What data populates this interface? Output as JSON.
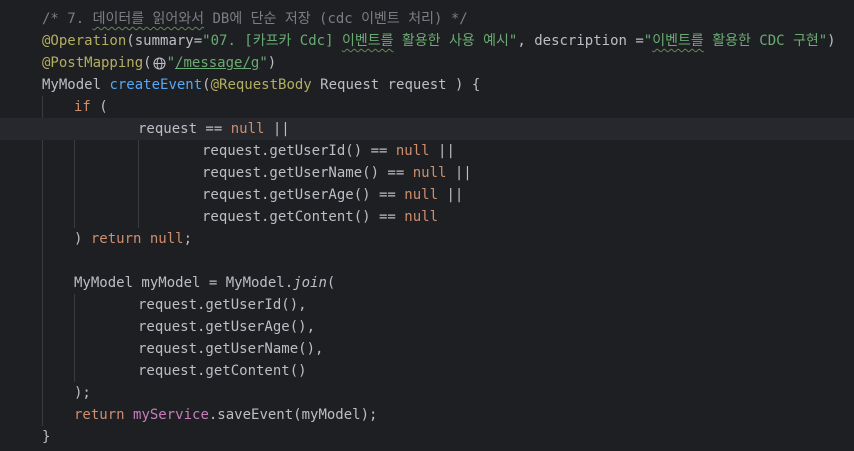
{
  "editor": {
    "lines": {
      "l1": {
        "comment_a": "/* 7. ",
        "comment_b": "데이터를 읽어와서",
        "comment_c": " DB에 단순 저장 (cdc 이벤트 처리) */"
      },
      "l2": {
        "annotation": "@Operation",
        "paren_open": "(summary=",
        "summary_a": "\"07. [카프카 Cdc] ",
        "summary_b": "이벤트를",
        "summary_c": " 활용한 사용 예시\"",
        "sep": ", description =",
        "desc_a": "\"",
        "desc_b": "이벤트를",
        "desc_c": " 활용한 CDC 구현\"",
        "close": ")"
      },
      "l3": {
        "annotation": "@PostMapping",
        "paren_open": "(",
        "quote_open": "\"",
        "path": "/message/g",
        "quote_close": "\"",
        "paren_close": ")"
      },
      "l4": {
        "type": "MyModel ",
        "method": "createEvent",
        "open": "(",
        "annotation": "@RequestBody",
        "rest": " Request request ) {"
      },
      "l5": {
        "kw": "if",
        "rest": " ("
      },
      "l6": {
        "text": "request == ",
        "kw": "null",
        "rest": " ||"
      },
      "l7": {
        "text": "request.getUserId() == ",
        "kw": "null",
        "rest": " ||"
      },
      "l8": {
        "text": "request.getUserName() == ",
        "kw": "null",
        "rest": " ||"
      },
      "l9": {
        "text": "request.getUserAge() == ",
        "kw": "null",
        "rest": " ||"
      },
      "l10": {
        "text": "request.getContent() == ",
        "kw": "null"
      },
      "l11": {
        "close": ") ",
        "kw_return": "return",
        "space": " ",
        "kw_null": "null",
        "semi": ";"
      },
      "l13": {
        "text": "MyModel myModel = MyModel.",
        "method": "join",
        "open": "("
      },
      "l14": {
        "text": "request.getUserId(),"
      },
      "l15": {
        "text": "request.getUserAge(),"
      },
      "l16": {
        "text": "request.getUserName(),"
      },
      "l17": {
        "text": "request.getContent()"
      },
      "l18": {
        "text": ");"
      },
      "l19": {
        "kw": "return",
        "space": " ",
        "field": "myService",
        "rest": ".saveEvent(myModel);"
      },
      "l20": {
        "text": "}"
      }
    }
  },
  "icons": {
    "intention": "lightbulb-icon",
    "url": "globe-icon"
  },
  "colors": {
    "background": "#1e1f22",
    "text": "#bcbec4",
    "comment": "#7a7e85",
    "annotation": "#b3ae60",
    "keyword": "#cf8e6d",
    "string": "#6aab73",
    "method": "#56a8f5",
    "field": "#c77dbb",
    "bulb": "#f2c55c"
  }
}
